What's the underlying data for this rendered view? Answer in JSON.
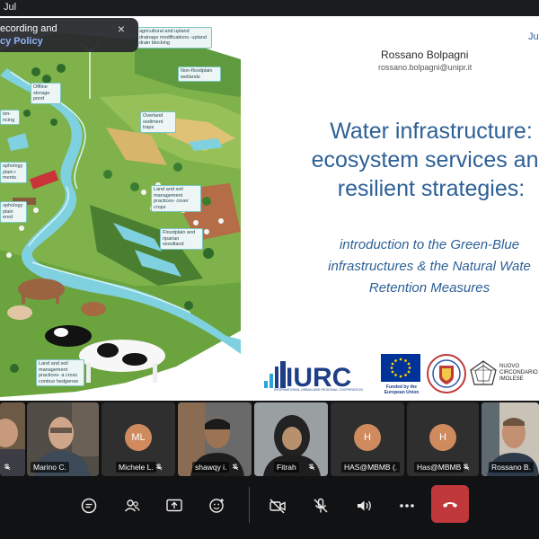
{
  "topbar": {
    "date": "Jul"
  },
  "notification": {
    "line1": "ecording and",
    "line2": "cy Policy",
    "close": "×"
  },
  "slide": {
    "presenter_name": "Rossano Bolpagni",
    "presenter_email": "rossano.bolpagni@unipr.it",
    "date": "Ju",
    "title_lines": [
      "Water infrastructure:",
      "ecosystem services and",
      "resilient strategies:"
    ],
    "subtitle_lines": [
      "introduction to the Green-Blue",
      "infrastructures & the Natural Wate",
      "Retention Measures"
    ],
    "callouts": [
      "agricultural and upland drainage modifications- upland drain blocking",
      "Offline storage pond",
      "Non-floodplain wetlands",
      "Overland sediment traps",
      "Land and soil management practices- cover crops",
      "Floodplain and riparian woodland",
      "Land and soil management practices- a cross contour hedgerow",
      "ophology plain r ments",
      "ophology plain ered",
      "ion- ncing"
    ],
    "logos": {
      "iurc": "IURC",
      "iurc_sub": "INTERNATIONAL URBAN AND REGIONAL COOPERATION",
      "eu": "Funded by the European Union",
      "nci": "NUOVO CIRCONDARIO IMOLESE",
      "eu_color": "#003399",
      "iurc_color": "#1e3f88"
    }
  },
  "participants": [
    {
      "name": "",
      "type": "video"
    },
    {
      "name": "Marino C.",
      "type": "video"
    },
    {
      "name": "Michele L.",
      "type": "avatar",
      "initials": "ML",
      "color": "#cf8a5e"
    },
    {
      "name": "shawqy i.",
      "type": "video"
    },
    {
      "name": "Fitrah",
      "type": "video"
    },
    {
      "name": "HAS@MBMB (.",
      "type": "avatar",
      "initials": "H",
      "color": "#cf8a5e"
    },
    {
      "name": "Has@MBMB",
      "type": "avatar",
      "initials": "H",
      "color": "#cf8a5e"
    },
    {
      "name": "Rossano B.",
      "type": "video"
    }
  ],
  "controls": {
    "chat": "chat-icon",
    "people": "people-icon",
    "share": "share-screen-icon",
    "reactions": "reaction-icon",
    "camera": "camera-off-icon",
    "mic": "mic-off-icon",
    "speaker": "speaker-icon",
    "more": "more-icon",
    "leave": "hangup-icon",
    "leave_color": "#c0383c"
  }
}
